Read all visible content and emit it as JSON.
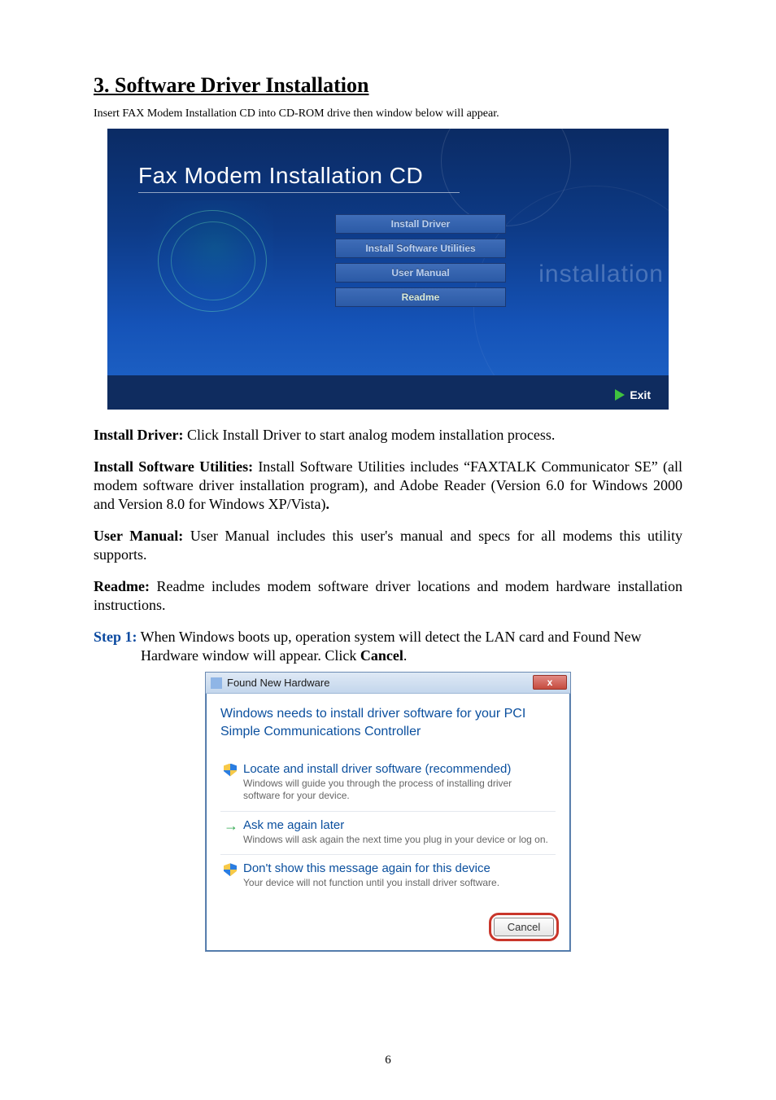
{
  "section_title": "3. Software Driver Installation",
  "intro": "Insert FAX Modem Installation CD into CD-ROM drive then window below will appear.",
  "cd": {
    "title": "Fax Modem Installation CD",
    "buttons": [
      "Install Driver",
      "Install Software Utilities",
      "User Manual",
      "Readme"
    ],
    "watermark": "installation",
    "exit": "Exit"
  },
  "paragraphs": {
    "install_driver_label": "Install Driver:",
    "install_driver_text": " Click Install Driver to start analog modem installation process.",
    "install_sw_label": "Install Software Utilities:",
    "install_sw_text": " Install Software Utilities includes “FAXTALK Communicator SE” (all modem software driver installation program), and Adobe Reader (Version 6.0 for Windows 2000 and Version 8.0 for Windows XP/Vista)",
    "install_sw_period": ".",
    "user_manual_label": "User Manual:",
    "user_manual_text": " User Manual includes this user's manual and specs for all modems this utility supports.",
    "readme_label": "Readme:",
    "readme_text": " Readme includes modem software driver locations and modem hardware installation instructions."
  },
  "step1": {
    "label": "Step 1:",
    "text_a": " When Windows boots up, operation system will detect the LAN card and Found New",
    "text_b": "Hardware window will appear. Click ",
    "cancel_word": "Cancel",
    "period": "."
  },
  "dialog": {
    "title": "Found New Hardware",
    "close": "x",
    "heading": "Windows needs to install driver software for your PCI Simple Communications Controller",
    "options": [
      {
        "title": "Locate and install driver software (recommended)",
        "desc": "Windows will guide you through the process of installing driver software for your device.",
        "icon": "shield"
      },
      {
        "title": "Ask me again later",
        "desc": "Windows will ask again the next time you plug in your device or log on.",
        "icon": "arrow"
      },
      {
        "title": "Don't show this message again for this device",
        "desc": "Your device will not function until you install driver software.",
        "icon": "shield"
      }
    ],
    "cancel": "Cancel"
  },
  "page_number": "6"
}
